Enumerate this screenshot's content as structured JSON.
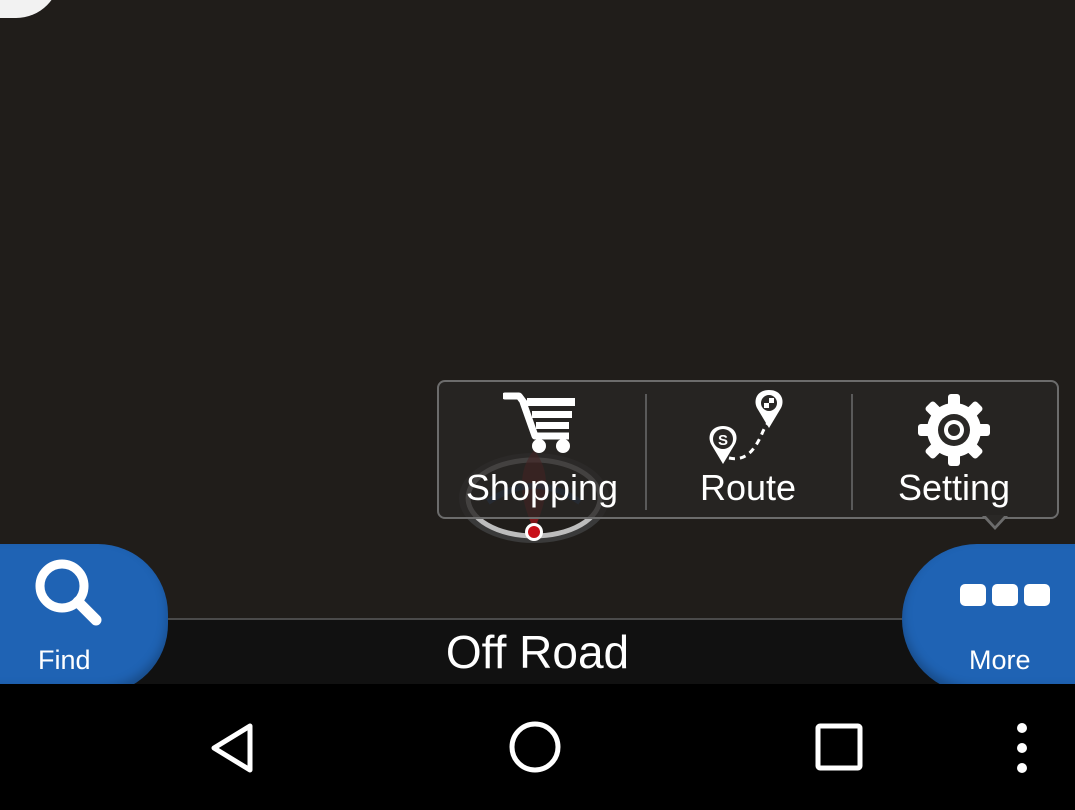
{
  "menu": {
    "items": [
      {
        "label": "Shopping",
        "icon": "shopping-cart-icon"
      },
      {
        "label": "Route",
        "icon": "route-icon"
      },
      {
        "label": "Setting",
        "icon": "gear-icon"
      }
    ]
  },
  "status": {
    "road_name": "Off Road"
  },
  "buttons": {
    "find_label": "Find",
    "more_label": "More"
  },
  "nav": {
    "icons": [
      "back-icon",
      "home-icon",
      "recents-icon",
      "overflow-menu-icon"
    ]
  },
  "colors": {
    "map_background": "#201d1a",
    "button_blue": "#1f63b4",
    "marker_red": "#c8101a"
  }
}
